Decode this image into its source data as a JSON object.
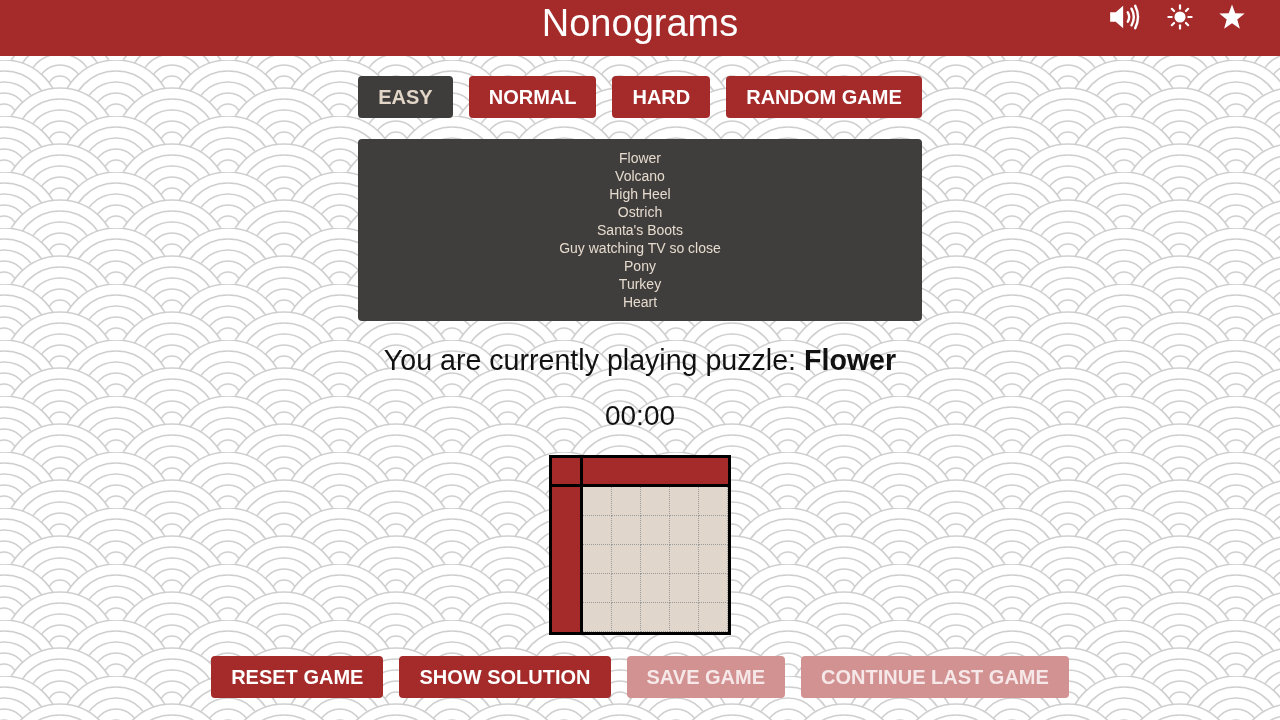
{
  "header": {
    "title": "Nonograms"
  },
  "difficulty_tabs": [
    {
      "label": "EASY",
      "selected": true
    },
    {
      "label": "NORMAL",
      "selected": false
    },
    {
      "label": "HARD",
      "selected": false
    },
    {
      "label": "RANDOM GAME",
      "selected": false
    }
  ],
  "puzzle_list": [
    "Flower",
    "Volcano",
    "High Heel",
    "Ostrich",
    "Santa's Boots",
    "Guy watching TV so close",
    "Pony",
    "Turkey",
    "Heart"
  ],
  "current_puzzle_text": "You are currently playing puzzle: **Flower**",
  "timer": "00:00",
  "board": {
    "rows": [
      {
        "cells": [
          {
            "filled": false
          },
          {
            "filled": false
          },
          {
            "filled": false
          },
          {
            "filled": false
          },
          {
            "filled": false
          }
        ]
      },
      {
        "cells": [
          {
            "filled": false
          },
          {
            "filled": false
          },
          {
            "filled": false
          },
          {
            "filled": false
          },
          {
            "filled": false
          }
        ]
      },
      {
        "cells": [
          {
            "filled": false
          },
          {
            "filled": false
          },
          {
            "filled": false
          },
          {
            "filled": false
          },
          {
            "filled": false
          }
        ]
      },
      {
        "cells": [
          {
            "filled": false
          },
          {
            "filled": false
          },
          {
            "filled": false
          },
          {
            "filled": false
          },
          {
            "filled": false
          }
        ]
      },
      {
        "cells": [
          {
            "filled": false
          },
          {
            "filled": false
          },
          {
            "filled": false
          },
          {
            "filled": false
          },
          {
            "filled": false
          }
        ]
      }
    ]
  },
  "actions": [
    {
      "label": "RESET GAME",
      "disabled": false
    },
    {
      "label": "SHOW SOLUTION",
      "disabled": false
    },
    {
      "label": "SAVE GAME",
      "disabled": true
    },
    {
      "label": "CONTINUE LAST GAME",
      "disabled": true
    }
  ]
}
